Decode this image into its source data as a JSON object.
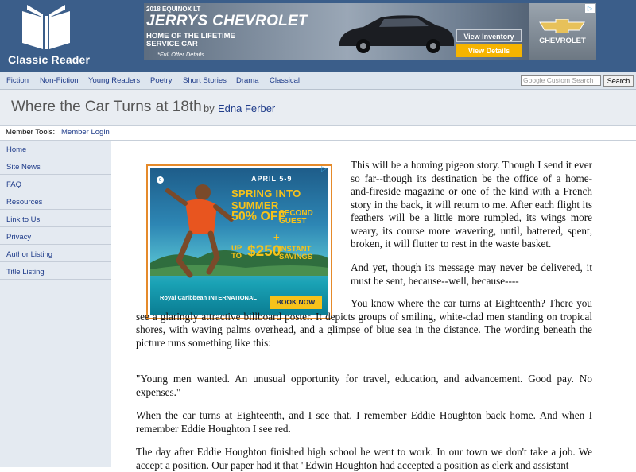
{
  "site": {
    "name": "Classic Reader"
  },
  "top_ad": {
    "model": "2018 EQUINOX LT",
    "dealer": "JERRYS CHEVROLET",
    "tagline": "HOME OF THE LIFETIME SERVICE CAR",
    "offer_note": "*Full Offer Details.",
    "view_inventory": "View Inventory",
    "view_details": "View Details",
    "brand": "CHEVROLET",
    "adchoice": "▷"
  },
  "nav": {
    "items": [
      "Fiction",
      "Non-Fiction",
      "Young Readers",
      "Poetry",
      "Short Stories",
      "Drama",
      "Classical"
    ],
    "search_placeholder": "Google Custom Search",
    "search_button": "Search"
  },
  "book": {
    "title": "Where the Car Turns at 18th",
    "by": "by",
    "author": "Edna Ferber"
  },
  "member": {
    "label": "Member Tools:",
    "login": "Member Login"
  },
  "sidebar": {
    "items": [
      "Home",
      "Site News",
      "FAQ",
      "Resources",
      "Link to Us",
      "Privacy",
      "Author Listing",
      "Title Listing"
    ]
  },
  "article_ad": {
    "dates": "APRIL 5-9",
    "spring": "SPRING INTO SUMMER",
    "pct": "50% OFF",
    "second": "SECOND GUEST",
    "plus": "+",
    "upto": "UP TO",
    "amount": "$250",
    "instant": "INSTANT SAVINGS",
    "brand": "Royal Caribbean INTERNATIONAL",
    "cta": "BOOK NOW",
    "adchoice": "▷"
  },
  "article": {
    "paragraphs": [
      "This will be a homing pigeon story. Though I send it ever so far--though its destination be the office of a home-and-fireside magazine or one of the kind with a French story in the back, it will return to me. After each flight its feathers will be a little more rumpled, its wings more weary, its course more wavering, until, battered, spent, broken, it will flutter to rest in the waste basket.",
      "And yet, though its message may never be delivered, it must be sent, because--well, because----",
      "You know where the car turns at Eighteenth? There you see a glaringly attractive billboard poster. It depicts groups of smiling, white-clad men standing on tropical shores, with waving palms overhead, and a glimpse of blue sea in the distance. The wording beneath the picture runs something like this:",
      "\"Young men wanted. An unusual opportunity for travel, education, and advancement. Good pay. No expenses.\"",
      "When the car turns at Eighteenth, and I see that, I remember Eddie Houghton back home. And when I remember Eddie Houghton I see red.",
      "The day after Eddie Houghton finished high school he went to work. In our town we don't take a job. We accept a position. Our paper had it that \"Edwin Houghton had accepted a position as clerk and assistant"
    ]
  }
}
